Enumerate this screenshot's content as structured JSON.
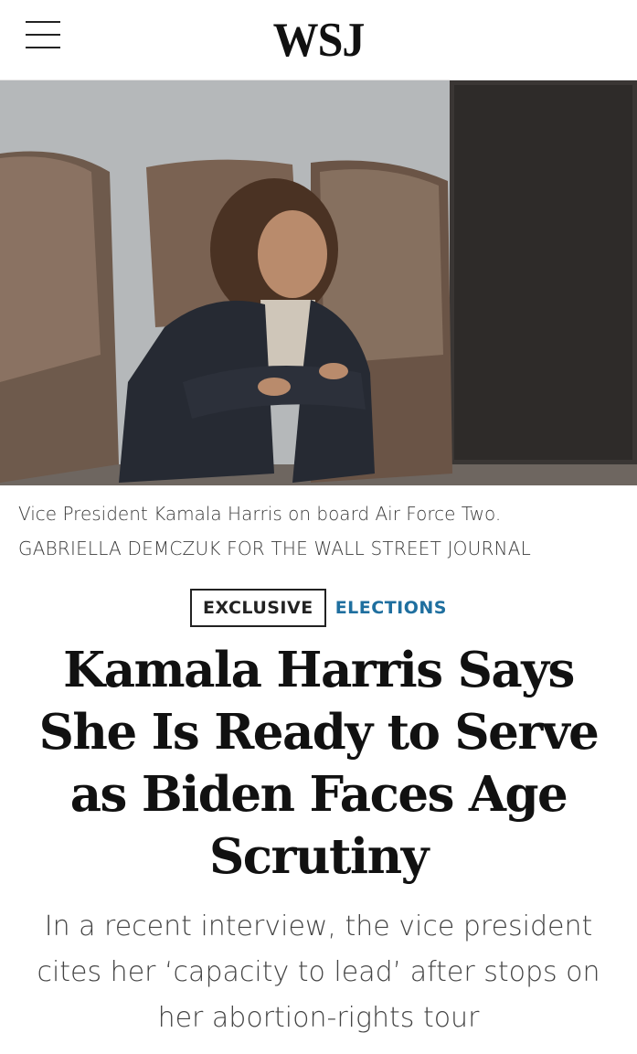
{
  "header": {
    "logo": "WSJ",
    "menu_icon": "hamburger-menu-icon"
  },
  "hero": {
    "image_description": "Photo of Vice President Kamala Harris seated on an airplane"
  },
  "caption": {
    "text": "Vice President Kamala Harris on board Air Force Two.",
    "credit": "GABRIELLA DEMCZUK FOR THE WALL STREET JOURNAL"
  },
  "tags": {
    "exclusive": "EXCLUSIVE",
    "section": "ELECTIONS"
  },
  "article": {
    "headline": "Kamala Harris Says She Is Ready to Serve as Biden Faces Age Scrutiny",
    "dek": "In a recent interview, the vice president cites her ‘capacity to lead’ after stops on her abortion-rights tour"
  },
  "colors": {
    "section_link": "#1f6f9f",
    "text": "#111111"
  }
}
